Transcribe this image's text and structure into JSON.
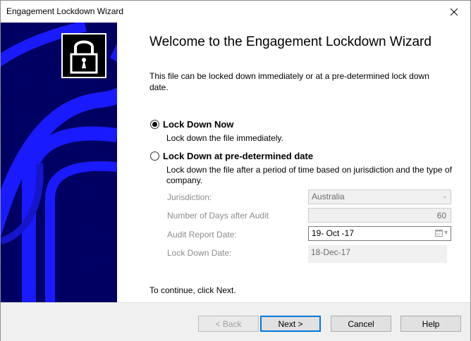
{
  "window": {
    "title": "Engagement Lockdown Wizard"
  },
  "heading": "Welcome to the Engagement Lockdown Wizard",
  "intro": "This file can be locked down immediately or at a pre-determined lock down date.",
  "options": {
    "now": {
      "label": "Lock Down Now",
      "description": "Lock down the file immediately.",
      "checked": true
    },
    "later": {
      "label": "Lock Down at pre-determined date",
      "description": "Lock down the file after a period of time based on jurisdiction and the type of company.",
      "checked": false
    }
  },
  "fields": {
    "jurisdiction": {
      "label": "Jurisdiction:",
      "value": "Australia"
    },
    "days": {
      "label": "Number of Days after Audit",
      "value": "60"
    },
    "audit_date": {
      "label": "Audit Report Date:",
      "value": "19- Oct -17"
    },
    "lockdown_date": {
      "label": "Lock Down Date:",
      "value": "18-Dec-17"
    }
  },
  "continue_text": "To continue, click Next.",
  "buttons": {
    "back": "< Back",
    "next": "Next >",
    "cancel": "Cancel",
    "help": "Help"
  },
  "icons": [
    "close-icon",
    "padlock-icon",
    "chevron-down-icon",
    "calendar-icon"
  ],
  "colors": {
    "side_panel": "#000066",
    "pattern": "#1a1aff",
    "accent": "#0078d7"
  }
}
